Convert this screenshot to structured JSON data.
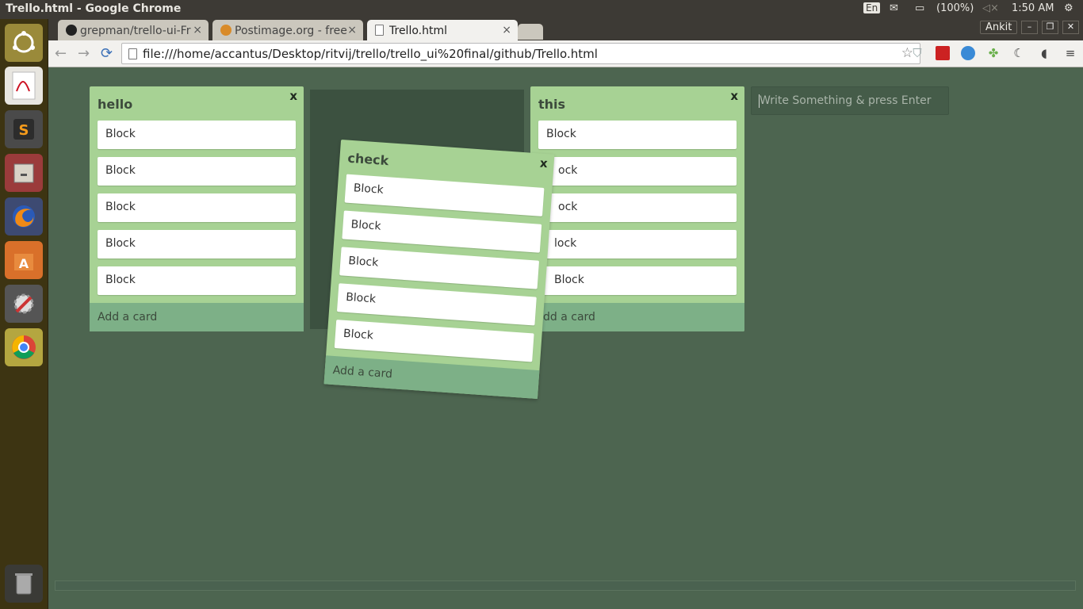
{
  "os": {
    "window_title": "Trello.html - Google Chrome",
    "keyboard_layout": "En",
    "battery": "(100%)",
    "time": "1:50 AM"
  },
  "browser": {
    "profile": "Ankit",
    "tabs": [
      {
        "label": "grepman/trello-ui-Fr",
        "icon": "github-icon"
      },
      {
        "label": "Postimage.org - free",
        "icon": "postimage-icon"
      },
      {
        "label": "Trello.html",
        "icon": "page-icon"
      }
    ],
    "address": "file:///home/accantus/Desktop/ritvij/trello/trello_ui%20final/github/Trello.html"
  },
  "board": {
    "lists": [
      {
        "title": "hello",
        "close": "x",
        "cards": [
          "Block",
          "Block",
          "Block",
          "Block",
          "Block"
        ],
        "add": "Add a card"
      },
      {
        "title": "check",
        "close": "x",
        "cards": [
          "Block",
          "Block",
          "Block",
          "Block",
          "Block"
        ],
        "add": "Add a card"
      },
      {
        "title": "this",
        "close": "x",
        "cards": [
          "Block",
          "ock",
          "ock",
          "lock",
          "Block"
        ],
        "add": "dd a card"
      }
    ],
    "new_list_placeholder": "Write Something & press Enter"
  },
  "colors": {
    "board_bg": "#4d6550",
    "list_bg": "#a7d294",
    "add_bg": "#7db087",
    "placeholder_bg": "#3c5140"
  }
}
